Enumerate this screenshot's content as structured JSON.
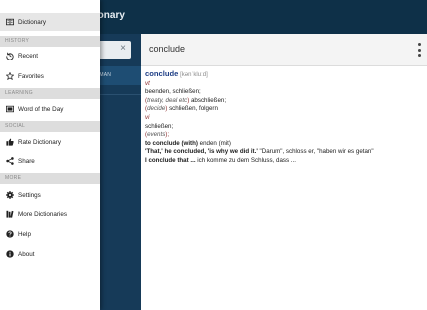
{
  "app": {
    "title_fragment": "ctionary"
  },
  "left_pane": {
    "clear_glyph": "×",
    "lang_label": "ERMAN"
  },
  "search": {
    "value": "conclude"
  },
  "entry": {
    "headword": "conclude",
    "ipa": "[kənˈkluːd]",
    "pos_vt": "vt",
    "sense1": "beenden, schließen;",
    "sense2_ctx_open": "(",
    "sense2_ctx": "treaty, deal etc",
    "sense2_ctx_close": ")",
    "sense2": " abschließen;",
    "sense3_ctx_open": "(",
    "sense3_ctx": "decide",
    "sense3_ctx_close": ")",
    "sense3": " schließen, folgern",
    "pos_vi": "vi",
    "sense4": "schließen;",
    "sense5_ctx_open": "(",
    "sense5_ctx": "events",
    "sense5_ctx_close": ");",
    "phrase1_bold": "to conclude (with)",
    "phrase1_rest": " enden (mit)",
    "example1_bold": "'That,' he concluded, 'is why we did it.'",
    "example1_rest": " \"Darum\", schloss er, \"haben wir es getan\"",
    "example2_bold": "I conclude that ...",
    "example2_rest": " ich komme zu dem Schluss, dass ..."
  },
  "drawer": {
    "items": [
      {
        "label": "Dictionary",
        "icon": "dictionary-icon"
      },
      {
        "label": "Recent",
        "icon": "recent-icon"
      },
      {
        "label": "Favorites",
        "icon": "star-icon"
      },
      {
        "label": "Word of the Day",
        "icon": "word-of-day-icon"
      },
      {
        "label": "Rate Dictionary",
        "icon": "thumbs-up-icon"
      },
      {
        "label": "Share",
        "icon": "share-icon"
      },
      {
        "label": "Settings",
        "icon": "gear-icon"
      },
      {
        "label": "More Dictionaries",
        "icon": "books-icon"
      },
      {
        "label": "Help",
        "icon": "help-icon"
      },
      {
        "label": "About",
        "icon": "info-icon"
      }
    ],
    "sections": {
      "history": "HISTORY",
      "learning": "LEARNING",
      "social": "SOCIAL",
      "more": "MORE"
    }
  },
  "colors": {
    "appbar": "#0e3048",
    "left_pane": "#163a58",
    "headword": "#1f3f86",
    "pos": "#8c2a2a"
  }
}
